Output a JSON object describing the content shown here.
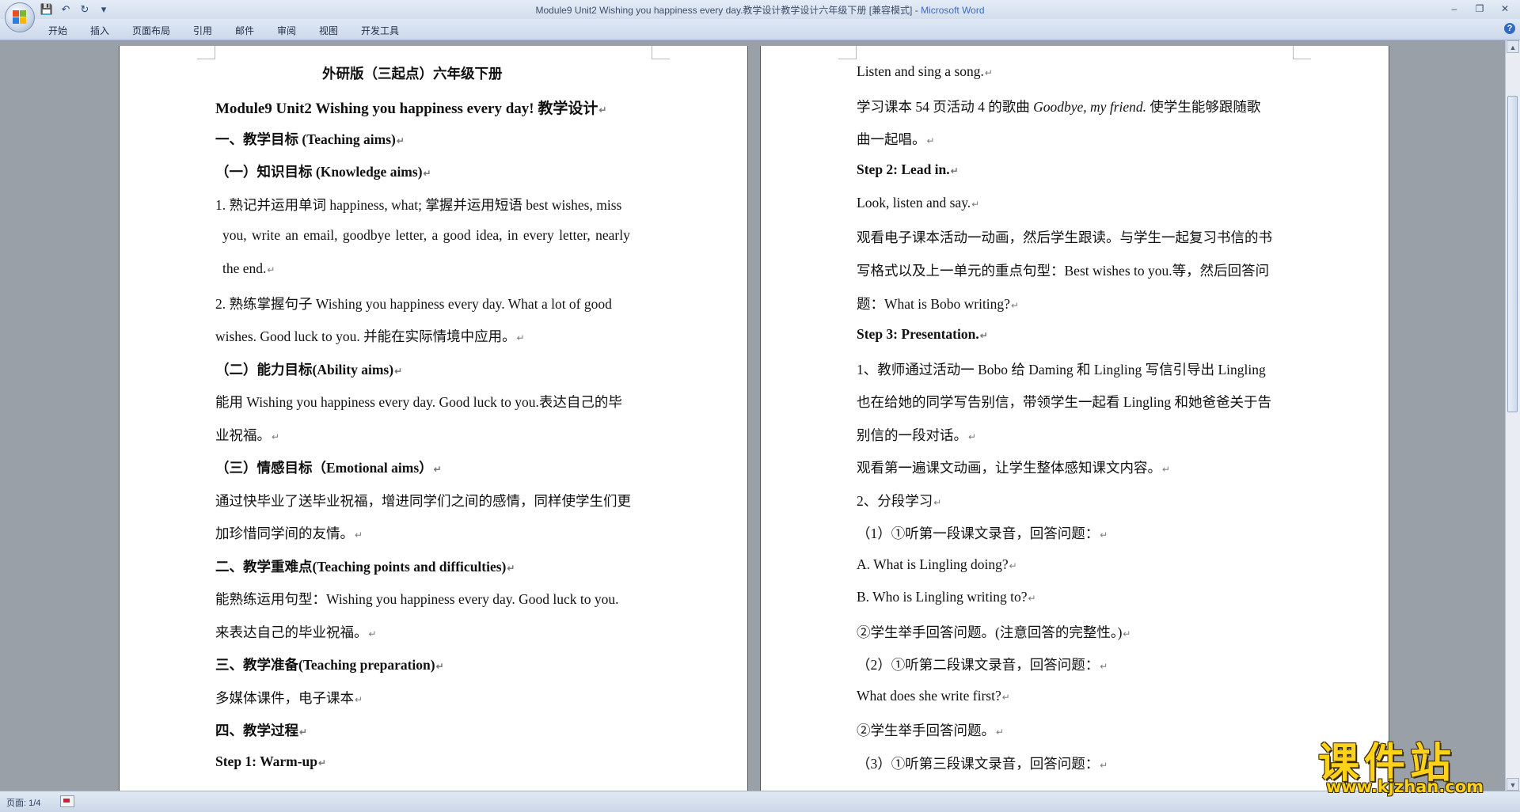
{
  "window": {
    "title": "Module9 Unit2 Wishing you happiness every day.教学设计教学设计六年级下册 [兼容模式] - ",
    "app_name": "Microsoft Word",
    "controls": [
      "–",
      "❐",
      "✕"
    ]
  },
  "quick_access": {
    "save": "💾",
    "undo": "↶",
    "redo": "↻",
    "customize": "▾"
  },
  "ribbon": {
    "tabs": [
      "开始",
      "插入",
      "页面布局",
      "引用",
      "邮件",
      "审阅",
      "视图",
      "开发工具"
    ],
    "help": "?"
  },
  "para_mark": "↵",
  "left_page": {
    "lines": [
      "外研版（三起点）六年级下册",
      "Module9 Unit2 Wishing  you happiness  every day!  教学设计",
      "一、教学目标 (Teaching aims)",
      "（一）知识目标 (Knowledge aims)",
      "1. 熟记并运用单词 happiness, what; 掌握并运用短语 best wishes, miss",
      "you, write an email, goodbye letter, a good idea, in every letter, nearly",
      "the end.",
      "2. 熟练掌握句子 Wishing you happiness every day. What a lot of good",
      "wishes. Good luck to you. 并能在实际情境中应用。",
      "（二）能力目标(Ability aims)",
      "能用 Wishing you happiness every day. Good luck to you.表达自己的毕",
      "业祝福。",
      "（三）情感目标（Emotional aims）",
      "通过快毕业了送毕业祝福，增进同学们之间的感情，同样使学生们更",
      "加珍惜同学间的友情。",
      "二、教学重难点(Teaching points and difficulties)",
      "能熟练运用句型：Wishing you happiness every day. Good luck to you.",
      "来表达自己的毕业祝福。",
      "三、教学准备(Teaching preparation)",
      "多媒体课件，电子课本",
      "四、教学过程",
      "Step 1: Warm-up"
    ]
  },
  "right_page": {
    "lines": [
      "Listen and sing a song.",
      "学习课本 54 页活动 4 的歌曲",
      "Goodbye, my friend.",
      "使学生能够跟随歌",
      "曲一起唱。",
      "Step 2: Lead in.",
      "Look, listen and say.",
      "观看电子课本活动一动画，然后学生跟读。与学生一起复习书信的书",
      "写格式以及上一单元的重点句型：Best wishes to you.等，然后回答问",
      "题：What is Bobo writing?",
      "Step 3: Presentation.",
      "1、教师通过活动一 Bobo 给 Daming 和 Lingling 写信引导出 Lingling",
      "也在给她的同学写告别信，带领学生一起看 Lingling 和她爸爸关于告",
      "别信的一段对话。",
      "观看第一遍课文动画，让学生整体感知课文内容。",
      "2、分段学习",
      "（1）①听第一段课文录音，回答问题：",
      "A. What is Lingling doing?",
      "B. Who is Lingling writing to?",
      "②学生举手回答问题。(注意回答的完整性。)",
      "（2）①听第二段课文录音，回答问题：",
      "What does she write first?",
      "②学生举手回答问题。",
      "（3）①听第三段课文录音，回答问题："
    ]
  },
  "scrollbar": {
    "up": "▲",
    "down": "▼"
  },
  "status": {
    "page": "页面: 1/4"
  },
  "watermark": {
    "brand": "课件站",
    "url": "www.kjzhan.com"
  }
}
